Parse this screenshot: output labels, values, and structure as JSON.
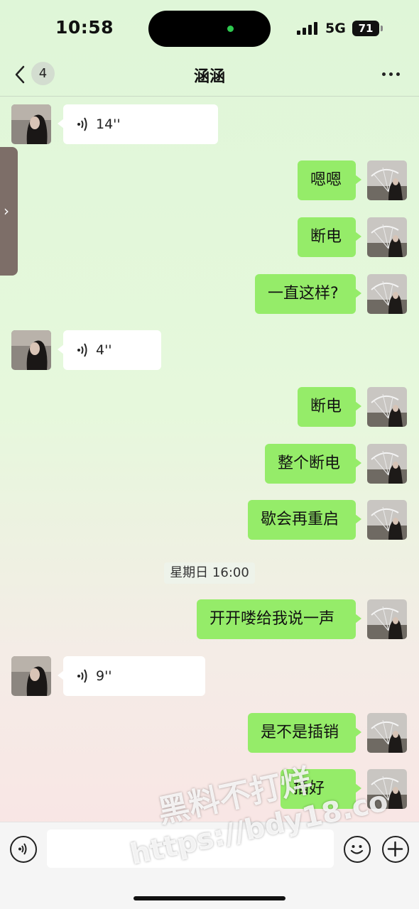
{
  "status_bar": {
    "time": "10:58",
    "network": "5G",
    "battery": "71"
  },
  "nav": {
    "back_count": "4",
    "title": "涵涵"
  },
  "messages": [
    {
      "from": "other",
      "type": "voice",
      "duration": "14''"
    },
    {
      "from": "self",
      "type": "text",
      "text": "嗯嗯"
    },
    {
      "from": "self",
      "type": "text",
      "text": "断电"
    },
    {
      "from": "self",
      "type": "text",
      "text": "一直这样?"
    },
    {
      "from": "other",
      "type": "voice",
      "duration": "4''"
    },
    {
      "from": "self",
      "type": "text",
      "text": "断电"
    },
    {
      "from": "self",
      "type": "text",
      "text": "整个断电"
    },
    {
      "from": "self",
      "type": "text",
      "text": "歇会再重启"
    },
    {
      "from": "self",
      "type": "text",
      "text": "开开喽给我说一声"
    },
    {
      "from": "other",
      "type": "voice",
      "duration": "9''"
    },
    {
      "from": "self",
      "type": "text",
      "text": "是不是插销"
    },
    {
      "from": "self",
      "type": "text",
      "text": "插好"
    }
  ],
  "timestamp": "星期日 16:00",
  "input": {
    "value": ""
  },
  "watermark": {
    "line1": "黑料不打烊",
    "line2": "https://bdy18.co"
  },
  "colors": {
    "self_bubble": "#95ec69",
    "other_bubble": "#ffffff"
  }
}
